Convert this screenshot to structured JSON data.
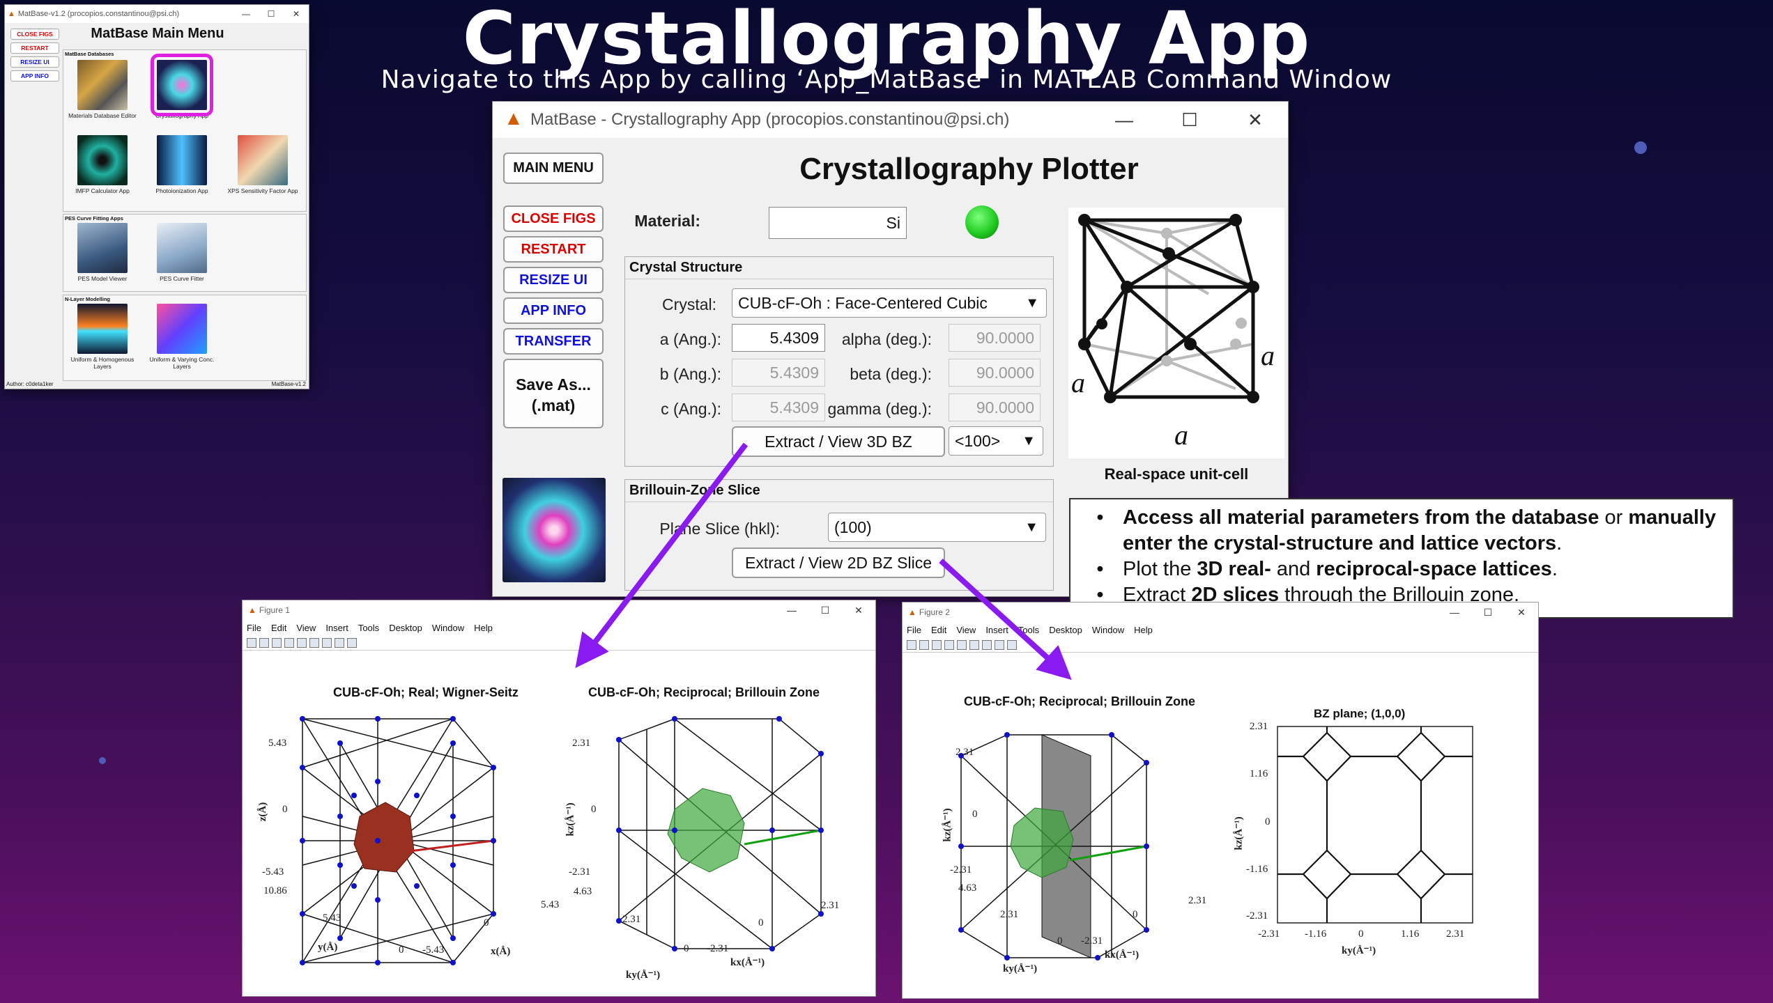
{
  "title": "Crystallography App",
  "subtitle": "Navigate to this App by calling ‘App_MatBase’ in MATLAB Command Window",
  "main_menu": {
    "window_title": "MatBase-v1.2 (procopios.constantinou@psi.ch)",
    "heading": "MatBase Main Menu",
    "buttons": [
      "CLOSE FIGS",
      "RESTART",
      "RESIZE UI",
      "APP INFO"
    ],
    "groups": [
      {
        "title": "MatBase Databases",
        "apps": [
          "Materials Database Editor",
          "Crystallography App",
          "IMFP Calculator App",
          "Photoionization App",
          "XPS Sensitivity Factor App"
        ]
      },
      {
        "title": "PES Curve Fitting Apps",
        "apps": [
          "PES Model Viewer",
          "PES Curve Fitter"
        ]
      },
      {
        "title": "N-Layer Modelling",
        "apps": [
          "Uniform & Homogenous Layers",
          "Uniform & Varying Conc. Layers"
        ]
      }
    ],
    "footer_left": "Author: c0deta1ker",
    "footer_right": "MatBase-v1.2"
  },
  "crystal_app": {
    "window_title": "MatBase - Crystallography App (procopios.constantinou@psi.ch)",
    "heading": "Crystallography Plotter",
    "side_buttons": {
      "main_menu": "MAIN MENU",
      "close_figs": "CLOSE FIGS",
      "restart": "RESTART",
      "resize_ui": "RESIZE UI",
      "app_info": "APP INFO",
      "transfer": "TRANSFER",
      "save_as_1": "Save As...",
      "save_as_2": "(.mat)"
    },
    "material_label": "Material:",
    "material_value": "Si",
    "status_color": "#22cc22",
    "crystal_structure": {
      "title": "Crystal Structure",
      "crystal_label": "Crystal:",
      "crystal_value": "CUB-cF-Oh : Face-Centered Cubic",
      "a_label": "a (Ang.):",
      "a_value": "5.4309",
      "b_label": "b (Ang.):",
      "b_value": "5.4309",
      "c_label": "c (Ang.):",
      "c_value": "5.4309",
      "alpha_label": "alpha (deg.):",
      "alpha_value": "90.0000",
      "beta_label": "beta (deg.):",
      "beta_value": "90.0000",
      "gamma_label": "gamma (deg.):",
      "gamma_value": "90.0000",
      "extract_3d": "Extract / View 3D BZ",
      "view_dir": "<100>"
    },
    "bz_slice": {
      "title": "Brillouin-Zone Slice",
      "plane_label": "Plane Slice (hkl):",
      "plane_value": "(100)",
      "extract_2d": "Extract / View 2D BZ Slice"
    },
    "unit_cell_caption": "Real-space unit-cell",
    "unit_cell_label": "a"
  },
  "info_bullets": [
    {
      "pre": "",
      "b1": "Access all material parameters from the database",
      "mid": " or ",
      "b2": "manually enter the crystal-structure and lattice vectors",
      "post": "."
    },
    {
      "pre": "Plot the ",
      "b1": "3D real-",
      "mid": " and ",
      "b2": "reciprocal-space lattices",
      "post": "."
    },
    {
      "pre": "Extract ",
      "b1": "2D slices",
      "mid": " through the Brillouin zone.",
      "b2": "",
      "post": ""
    }
  ],
  "bullet_char": "•",
  "figure1": {
    "title": "Figure 1",
    "menus": [
      "File",
      "Edit",
      "View",
      "Insert",
      "Tools",
      "Desktop",
      "Window",
      "Help"
    ],
    "plot1_title": "CUB-cF-Oh; Real; Wigner-Seitz",
    "plot1_z_label": "z(Å)",
    "plot1_y_label": "y(Å)",
    "plot1_x_label": "x(Å)",
    "plot1_ticks": {
      "z_top": "5.43",
      "z_mid": "0",
      "z_bot": "-5.43",
      "y_10": "10.86",
      "y_5": "5.43",
      "y_0": "0",
      "x_m5": "-5.43",
      "x_0": "0",
      "x_5": "5.43"
    },
    "plot2_title": "CUB-cF-Oh; Reciprocal; Brillouin Zone",
    "plot2_z_label": "kz(Å⁻¹)",
    "plot2_y_label": "ky(Å⁻¹)",
    "plot2_x_label": "kx(Å⁻¹)",
    "plot2_ticks": {
      "z_top": "2.31",
      "z_mid": "0",
      "z_bot": "-2.31",
      "y_4": "4.63",
      "y_2": "2.31",
      "y_0": "0",
      "x_m2": "-2.31",
      "x_2": "2.31"
    }
  },
  "figure2": {
    "title": "Figure 2",
    "menus": [
      "File",
      "Edit",
      "View",
      "Insert",
      "Tools",
      "Desktop",
      "Window",
      "Help"
    ],
    "plot1_title": "CUB-cF-Oh; Reciprocal; Brillouin Zone",
    "plot1_z_label": "kz(Å⁻¹)",
    "plot1_y_label": "ky(Å⁻¹)",
    "plot1_x_label": "kx(Å⁻¹)",
    "plot1_ticks": {
      "z_top": "2.31",
      "z_mid": "0",
      "z_bot": "-2.31",
      "y_4": "4.63",
      "y_2": "2.31",
      "y_0": "0",
      "x_m2": "-2.31",
      "x_2": "2.31"
    },
    "plot2_title": "BZ plane; (1,0,0)",
    "plot2_ylabel": "kz(Å⁻¹)",
    "plot2_xlabel": "ky(Å⁻¹)",
    "plot2_yticks": [
      "2.31",
      "1.16",
      "0",
      "-1.16",
      "-2.31"
    ],
    "plot2_xticks": [
      "-2.31",
      "-1.16",
      "0",
      "1.16",
      "2.31"
    ]
  },
  "colors": {
    "accent_purple": "#8a1bf0",
    "highlight_magenta": "#e020e0",
    "red_text": "#dd0000",
    "blue_text": "#1010dd",
    "node_blue": "#1010cc"
  }
}
